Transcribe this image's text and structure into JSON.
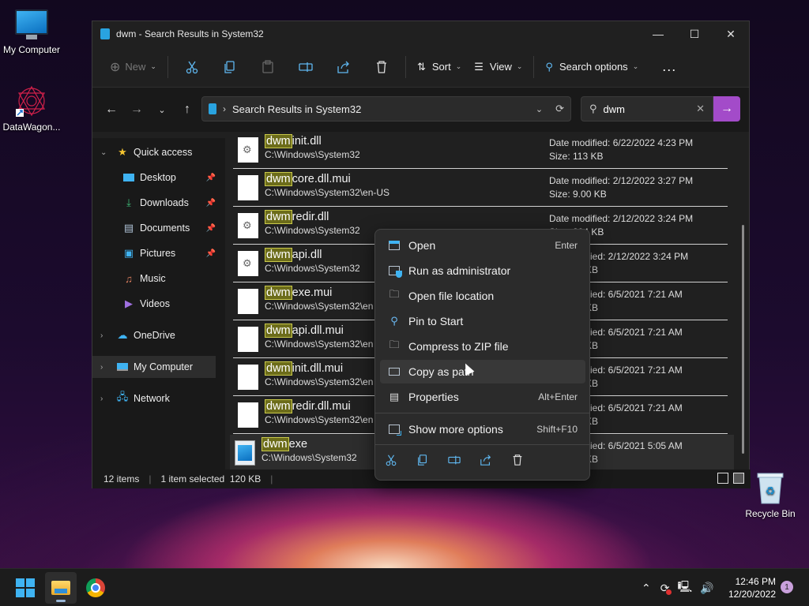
{
  "desktop": {
    "icons": [
      {
        "label": "My Computer"
      },
      {
        "label": "DataWagon..."
      },
      {
        "label": "Recycle Bin"
      }
    ]
  },
  "window": {
    "title": "dwm - Search Results in System32",
    "toolbar": {
      "new_label": "New",
      "sort_label": "Sort",
      "view_label": "View",
      "search_options_label": "Search options",
      "more_label": "..."
    },
    "address": {
      "path": "Search Results in System32"
    },
    "search": {
      "value": "dwm"
    },
    "sidebar": {
      "items": [
        {
          "label": "Quick access"
        },
        {
          "label": "Desktop"
        },
        {
          "label": "Downloads"
        },
        {
          "label": "Documents"
        },
        {
          "label": "Pictures"
        },
        {
          "label": "Music"
        },
        {
          "label": "Videos"
        },
        {
          "label": "OneDrive"
        },
        {
          "label": "My Computer"
        },
        {
          "label": "Network"
        }
      ]
    },
    "files": [
      {
        "hl": "dwm",
        "rest": "init.dll",
        "path": "C:\\Windows\\System32",
        "modified": "Date modified: 6/22/2022 4:23 PM",
        "size": "Size: 113 KB"
      },
      {
        "hl": "dwm",
        "rest": "core.dll.mui",
        "path": "C:\\Windows\\System32\\en-US",
        "modified": "Date modified: 2/12/2022 3:27 PM",
        "size": "Size: 9.00 KB"
      },
      {
        "hl": "dwm",
        "rest": "redir.dll",
        "path": "C:\\Windows\\System32",
        "modified": "Date modified: 2/12/2022 3:24 PM",
        "size": "Size: 204 KB"
      },
      {
        "hl": "dwm",
        "rest": "api.dll",
        "path": "C:\\Windows\\System32",
        "modified": "ified: 2/12/2022 3:24 PM",
        "size": "KB"
      },
      {
        "hl": "dwm",
        "rest": "exe.mui",
        "path": "C:\\Windows\\System32\\en",
        "modified": "ified: 6/5/2021 7:21 AM",
        "size": "KB"
      },
      {
        "hl": "dwm",
        "rest": "api.dll.mui",
        "path": "C:\\Windows\\System32\\en",
        "modified": "ified: 6/5/2021 7:21 AM",
        "size": "KB"
      },
      {
        "hl": "dwm",
        "rest": "init.dll.mui",
        "path": "C:\\Windows\\System32\\en",
        "modified": "ified: 6/5/2021 7:21 AM",
        "size": "KB"
      },
      {
        "hl": "dwm",
        "rest": "redir.dll.mui",
        "path": "C:\\Windows\\System32\\en",
        "modified": "ified: 6/5/2021 7:21 AM",
        "size": "KB"
      },
      {
        "hl": "dwm",
        "rest": "exe",
        "path": "C:\\Windows\\System32",
        "modified": "ified: 6/5/2021 5:05 AM",
        "size": "KB"
      }
    ],
    "status": {
      "count": "12 items",
      "selection": "1 item selected  120 KB"
    }
  },
  "context_menu": {
    "items": [
      {
        "label": "Open",
        "shortcut": "Enter"
      },
      {
        "label": "Run as administrator",
        "shortcut": ""
      },
      {
        "label": "Open file location",
        "shortcut": ""
      },
      {
        "label": "Pin to Start",
        "shortcut": ""
      },
      {
        "label": "Compress to ZIP file",
        "shortcut": ""
      },
      {
        "label": "Copy as path",
        "shortcut": ""
      },
      {
        "label": "Properties",
        "shortcut": "Alt+Enter"
      },
      {
        "label": "Show more options",
        "shortcut": "Shift+F10"
      }
    ]
  },
  "taskbar": {
    "time": "12:46 PM",
    "date": "12/20/2022",
    "notification_count": "1"
  },
  "colors": {
    "accent": "#a34bc9",
    "highlight": "#6c6c1a",
    "icon_blue": "#5fb7f0"
  }
}
